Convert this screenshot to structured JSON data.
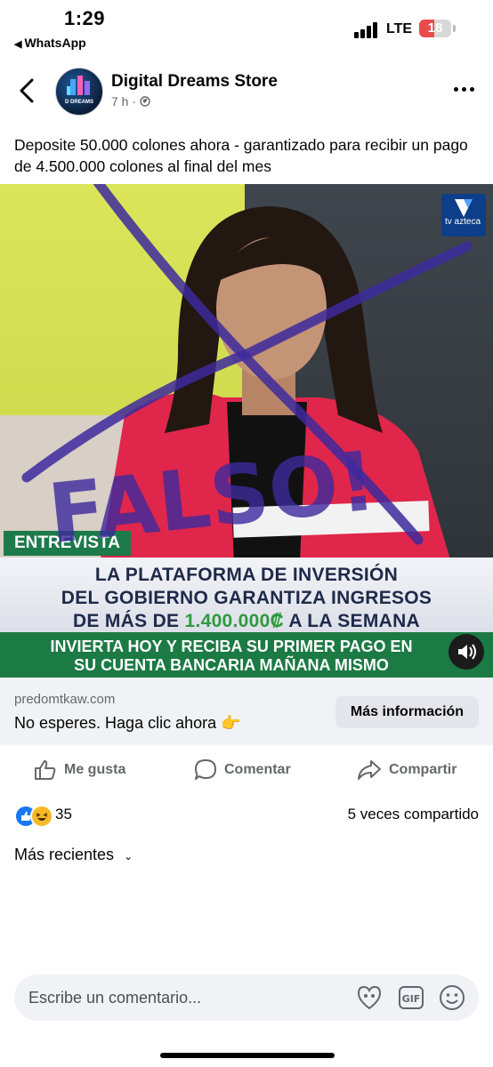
{
  "status_bar": {
    "time": "1:29",
    "back_app": "WhatsApp",
    "network": "LTE",
    "battery": "18"
  },
  "header": {
    "store_name": "Digital Dreams Store",
    "time_ago": "7 h",
    "avatar_text": "D DREAMS"
  },
  "post": {
    "caption": "Deposite 50.000 colones ahora - garantizado para recibir un pago de 4.500.000 colones al final del mes"
  },
  "media": {
    "logo": "tv azteca",
    "chyron_label": "ENTREVISTA",
    "headline_1": "LA PLATAFORMA DE INVERSIÓN",
    "headline_2": "DEL GOBIERNO GARANTIZA INGRESOS",
    "headline_3a": "DE MÁS DE ",
    "headline_3_amount": "1.400.000₡",
    "headline_3b": " A LA SEMANA",
    "subline_1": "INVIERTA HOY Y RECIBA SU PRIMER PAGO EN",
    "subline_2": "SU CUENTA BANCARIA MAÑANA MISMO",
    "overlay_text": "FALSO!"
  },
  "link_preview": {
    "domain": "predomtkaw.com",
    "cta": "No esperes. Haga clic ahora 👉",
    "button": "Más información"
  },
  "actions": {
    "like": "Me gusta",
    "comment": "Comentar",
    "share": "Compartir"
  },
  "stats": {
    "reactions": "35",
    "shares": "5 veces compartido"
  },
  "sort": {
    "label": "Más recientes"
  },
  "comment_input": {
    "placeholder": "Escribe un comentario..."
  },
  "colors": {
    "facebook_blue": "#1877f2",
    "tv_green": "#1c7a44",
    "scribble_purple": "#3d2a9e",
    "amount_green": "#2e9a3e"
  }
}
